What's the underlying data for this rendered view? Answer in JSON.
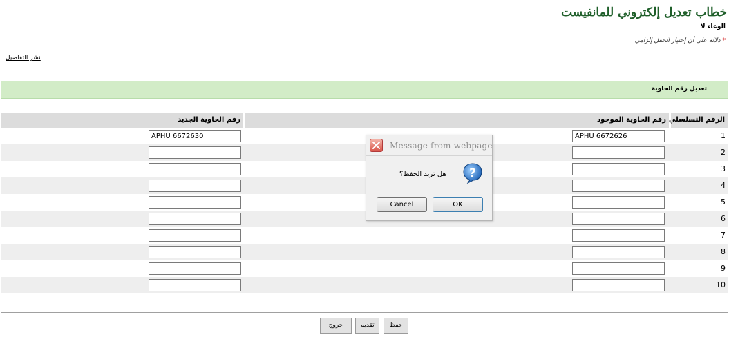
{
  "header": {
    "title": "خطاب تعديل إلكتروني للمانفيست",
    "subline": "الوعاء لا",
    "required_star": "*",
    "required_note": "دلالة على أن إختيار الحقل إلزامي"
  },
  "print_link": "نشر التفاصيل",
  "section_title": "تعديل رقم الحاوية",
  "table": {
    "headers": {
      "serial": "الرقم التسلسلي",
      "existing": "رقم الحاوية الموجود",
      "new": "رقم الحاوية الجديد"
    },
    "rows": [
      {
        "serial": "1",
        "existing": "APHU 6672626",
        "new": "APHU 6672630"
      },
      {
        "serial": "2",
        "existing": "",
        "new": ""
      },
      {
        "serial": "3",
        "existing": "",
        "new": ""
      },
      {
        "serial": "4",
        "existing": "",
        "new": ""
      },
      {
        "serial": "5",
        "existing": "",
        "new": ""
      },
      {
        "serial": "6",
        "existing": "",
        "new": ""
      },
      {
        "serial": "7",
        "existing": "",
        "new": ""
      },
      {
        "serial": "8",
        "existing": "",
        "new": ""
      },
      {
        "serial": "9",
        "existing": "",
        "new": ""
      },
      {
        "serial": "10",
        "existing": "",
        "new": ""
      }
    ]
  },
  "buttons": {
    "exit": "خروج",
    "submit": "تقديم",
    "save": "حفظ"
  },
  "dialog": {
    "title": "Message from webpage",
    "message": "هل تريد الحفظ؟",
    "icon": "question-icon",
    "cancel": "Cancel",
    "ok": "OK"
  },
  "colors": {
    "title": "#1f5f2a",
    "section_bar": "#d2ecc7",
    "header_bar": "#dcdcdc"
  }
}
